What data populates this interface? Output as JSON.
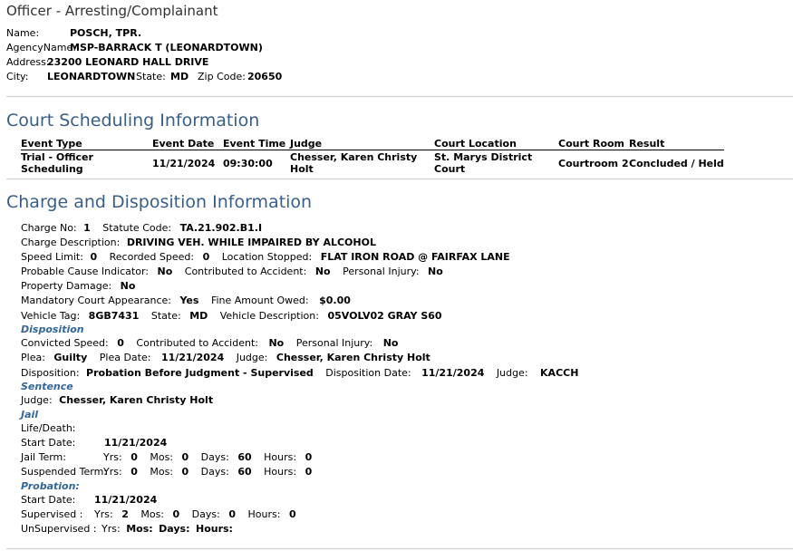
{
  "officer": {
    "title": "Officer - Arresting/Complainant",
    "name_label": "Name:",
    "name": "POSCH, TPR.",
    "agency_label": "AgencyName:",
    "agency": "MSP-BARRACK T (LEONARDTOWN)",
    "address_label": "Address:",
    "address": "23200 LEONARD HALL DRIVE",
    "city_label": "City:",
    "city": "LEONARDTOWN",
    "state_label": "State:",
    "state": "MD",
    "zip_label": "Zip Code:",
    "zip": "20650"
  },
  "court": {
    "title": "Court Scheduling Information",
    "headers": [
      "Event Type",
      "Event Date",
      "Event Time",
      "Judge",
      "Court Location",
      "Court Room",
      "Result"
    ],
    "rows": [
      [
        "Trial - Officer Scheduling",
        "11/21/2024",
        "09:30:00",
        "Chesser, Karen Christy Holt",
        "St. Marys District Court",
        "Courtroom 2",
        "Concluded / Held"
      ]
    ]
  },
  "charge": {
    "title": "Charge and Disposition Information",
    "charge_no_label": "Charge No:",
    "charge_no": "1",
    "statute_label": "Statute Code:",
    "statute": "TA.21.902.B1.I",
    "description_label": "Charge Description:",
    "description": "DRIVING VEH. WHILE IMPAIRED BY ALCOHOL",
    "speed_limit_label": "Speed Limit:",
    "speed_limit": "0",
    "recorded_speed_label": "Recorded Speed:",
    "recorded_speed": "0",
    "location_label": "Location Stopped:",
    "location": "FLAT IRON ROAD @ FAIRFAX LANE",
    "probable_cause_label": "Probable Cause Indicator:",
    "probable_cause": "No",
    "contrib_label": "Contributed to Accident:",
    "contrib": "No",
    "injury_label": "Personal Injury:",
    "injury": "No",
    "property_label": "Property Damage:",
    "property": "No",
    "mandatory_label": "Mandatory Court Appearance:",
    "mandatory": "Yes",
    "fine_label": "Fine Amount Owed:",
    "fine": "$0.00",
    "tag_label": "Vehicle Tag:",
    "tag": "8GB7431",
    "veh_state_label": "State:",
    "veh_state": "MD",
    "veh_desc_label": "Vehicle Description:",
    "veh_desc": "05VOLV02 GRAY S60"
  },
  "disposition": {
    "heading": "Disposition",
    "conv_speed_label": "Convicted Speed:",
    "conv_speed": "0",
    "contrib_label": "Contributed to Accident:",
    "contrib": "No",
    "injury_label": "Personal Injury:",
    "injury": "No",
    "plea_label": "Plea:",
    "plea": "Guilty",
    "plea_date_label": "Plea Date:",
    "plea_date": "11/21/2024",
    "judge_label": "Judge:",
    "judge": "Chesser, Karen Christy Holt",
    "disp_label": "Disposition:",
    "disp": "Probation Before Judgment - Supervised",
    "disp_date_label": "Disposition Date:",
    "disp_date": "11/21/2024",
    "disp_judge_label": "Judge:",
    "disp_judge": "KACCH"
  },
  "sentence": {
    "heading": "Sentence",
    "judge_label": "Judge:",
    "judge": "Chesser, Karen Christy Holt"
  },
  "jail": {
    "heading": "Jail",
    "life_label": "Life/Death:",
    "start_label": "Start Date:",
    "start": "11/21/2024",
    "term_label": "Jail Term:",
    "susp_label": "Suspended Term:",
    "yrs_label": "Yrs:",
    "mos_label": "Mos:",
    "days_label": "Days:",
    "hours_label": "Hours:",
    "term_yrs": "0",
    "term_mos": "0",
    "term_days": "60",
    "term_hours": "0",
    "susp_yrs": "0",
    "susp_mos": "0",
    "susp_days": "60",
    "susp_hours": "0"
  },
  "probation": {
    "heading": "Probation:",
    "start_label": "Start Date:",
    "start": "11/21/2024",
    "sup_label": "Supervised :",
    "unsup_label": "UnSupervised :",
    "yrs_label": "Yrs:",
    "mos_label": "Mos:",
    "days_label": "Days:",
    "hours_label": "Hours:",
    "sup_yrs": "2",
    "sup_mos": "0",
    "sup_days": "0",
    "sup_hours": "0"
  }
}
